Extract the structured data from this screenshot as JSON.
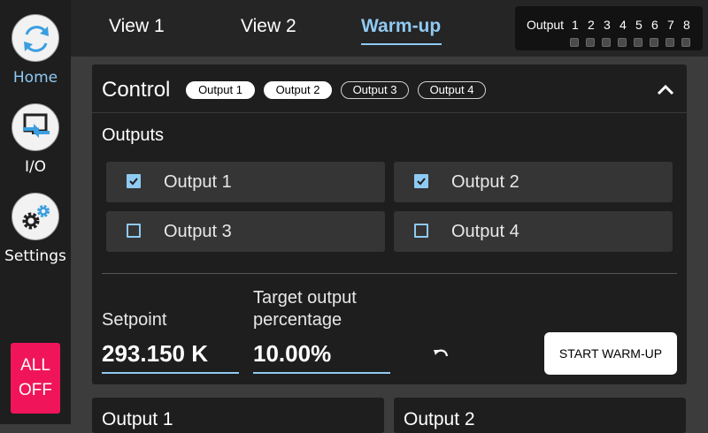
{
  "sidebar": {
    "items": [
      {
        "label": "Home",
        "icon": "sync-icon"
      },
      {
        "label": "I/O",
        "icon": "io-transfer-icon"
      },
      {
        "label": "Settings",
        "icon": "gears-icon"
      }
    ],
    "all_off": {
      "line1": "ALL",
      "line2": "OFF"
    }
  },
  "tabs": [
    {
      "label": "View 1"
    },
    {
      "label": "View 2"
    },
    {
      "label": "Warm-up",
      "active": true
    }
  ],
  "output_indicator": {
    "label": "Output",
    "channels": [
      "1",
      "2",
      "3",
      "4",
      "5",
      "6",
      "7",
      "8"
    ]
  },
  "control": {
    "title": "Control",
    "chips": [
      {
        "label": "Output 1",
        "selected": true
      },
      {
        "label": "Output 2",
        "selected": true
      },
      {
        "label": "Output 3",
        "selected": false
      },
      {
        "label": "Output 4",
        "selected": false
      }
    ],
    "outputs_heading": "Outputs",
    "outputs": [
      {
        "label": "Output 1",
        "checked": true
      },
      {
        "label": "Output 2",
        "checked": true
      },
      {
        "label": "Output 3",
        "checked": false
      },
      {
        "label": "Output 4",
        "checked": false
      }
    ],
    "setpoint": {
      "label": "Setpoint",
      "value": "293.150 K"
    },
    "target": {
      "label_line1": "Target output",
      "label_line2": "percentage",
      "value": "10.00%"
    },
    "start_button": "START WARM-UP"
  },
  "bottom_cards": [
    {
      "title": "Output 1"
    },
    {
      "title": "Output 2"
    }
  ],
  "colors": {
    "accent": "#8fcaf2",
    "danger": "#f0145a",
    "background": "#3c3c3c"
  }
}
